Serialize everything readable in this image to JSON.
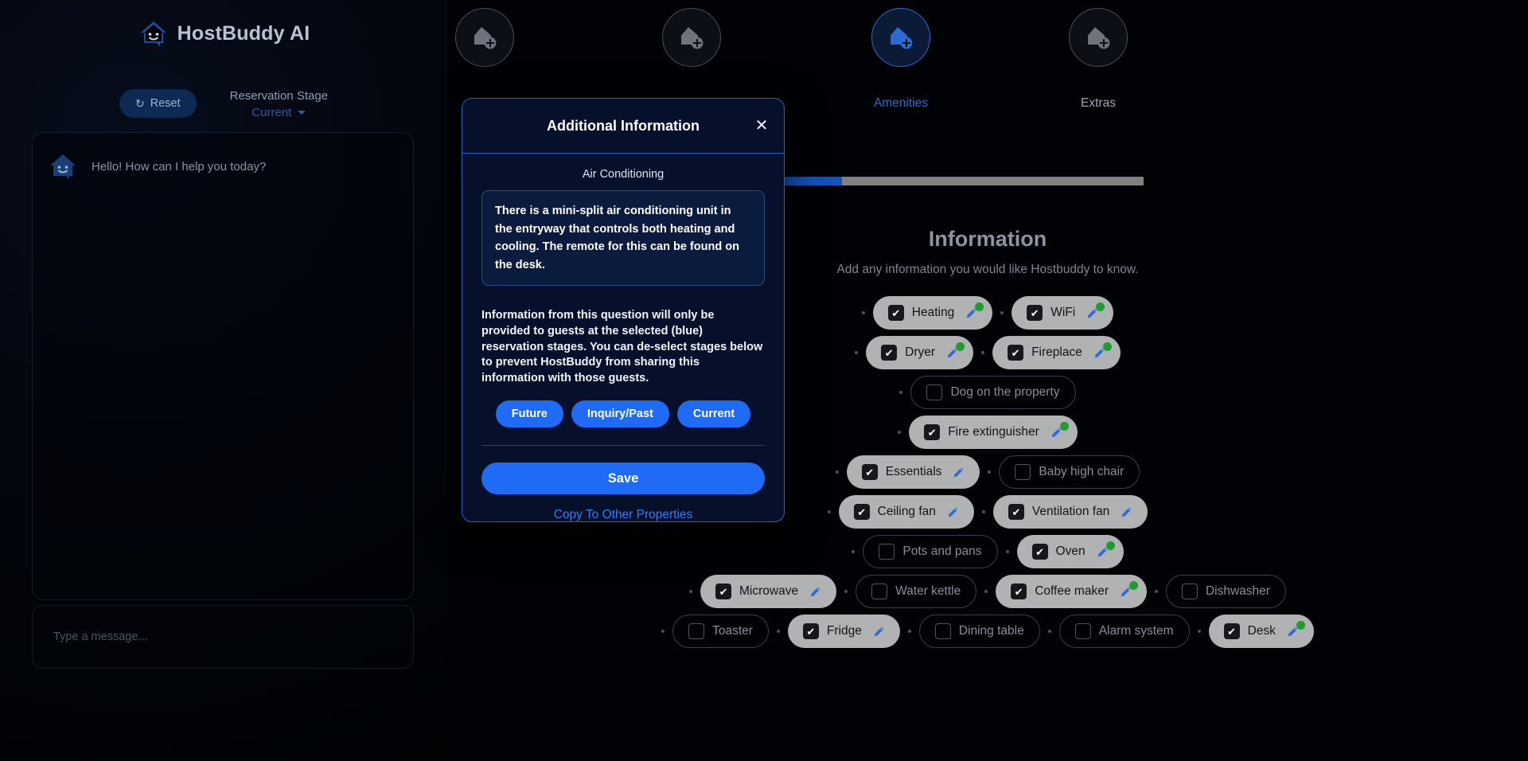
{
  "chat": {
    "brand": "HostBuddy AI",
    "brand_icon": "house-smile-logo",
    "reset_label": "Reset",
    "reset_icon": "refresh-icon",
    "stage_label": "Reservation Stage",
    "stage_value": "Current",
    "stage_caret_icon": "chevron-down-icon",
    "greeting": "Hello! How can I help you today?",
    "greeting_avatar_icon": "house-smile-avatar",
    "input_placeholder": "Type a message..."
  },
  "wizard": {
    "steps": [
      {
        "label": "",
        "icon": "house-plus-icon",
        "active": false
      },
      {
        "label": "",
        "icon": "house-plus-icon",
        "active": false
      },
      {
        "label": "Amenities",
        "icon": "house-plus-icon",
        "active": true
      },
      {
        "label": "Extras",
        "icon": "house-plus-icon",
        "active": false
      }
    ],
    "progress_percent": 48,
    "heading": "Information",
    "subheading": "Add any information you would like Hostbuddy to know.",
    "rows": [
      [
        {
          "label": "Heating",
          "checked": true,
          "edited": true
        },
        {
          "label": "WiFi",
          "checked": true,
          "edited": true
        }
      ],
      [
        {
          "label": "Dryer",
          "checked": true,
          "edited": true
        },
        {
          "label": "Fireplace",
          "checked": true,
          "edited": true
        }
      ],
      [
        {
          "label": "Dog on the property",
          "checked": false,
          "edited": false
        }
      ],
      [
        {
          "label": "Fire extinguisher",
          "checked": true,
          "edited": true
        }
      ],
      [
        {
          "label": "Essentials",
          "checked": true,
          "edited": false
        },
        {
          "label": "Baby high chair",
          "checked": false,
          "edited": false
        }
      ],
      [
        {
          "label": "Ceiling fan",
          "checked": true,
          "edited": false
        },
        {
          "label": "Ventilation fan",
          "checked": true,
          "edited": false
        }
      ],
      [
        {
          "label": "Pots and pans",
          "checked": false,
          "edited": false
        },
        {
          "label": "Oven",
          "checked": true,
          "edited": true
        }
      ],
      [
        {
          "label": "Microwave",
          "checked": true,
          "edited": false
        },
        {
          "label": "Water kettle",
          "checked": false,
          "edited": false
        },
        {
          "label": "Coffee maker",
          "checked": true,
          "edited": true
        },
        {
          "label": "Dishwasher",
          "checked": false,
          "edited": false
        }
      ],
      [
        {
          "label": "Toaster",
          "checked": false,
          "edited": false
        },
        {
          "label": "Fridge",
          "checked": true,
          "edited": false
        },
        {
          "label": "Dining table",
          "checked": false,
          "edited": false
        },
        {
          "label": "Alarm system",
          "checked": false,
          "edited": false
        },
        {
          "label": "Desk",
          "checked": true,
          "edited": true
        }
      ]
    ]
  },
  "modal": {
    "title": "Additional Information",
    "close_icon": "close-icon",
    "field_label": "Air Conditioning",
    "answer_text": "There is a mini-split air conditioning unit in the entryway that controls both heating and cooling. The remote for this can be found on the desk.",
    "stage_note": "Information from this question will only be provided to guests at the selected (blue) reservation stages. You can de-select stages below to prevent HostBuddy from sharing this information with those guests.",
    "stage_pills": [
      {
        "label": "Future",
        "selected": true
      },
      {
        "label": "Inquiry/Past",
        "selected": true
      },
      {
        "label": "Current",
        "selected": true
      }
    ],
    "save_label": "Save",
    "copy_label": "Copy To Other Properties"
  },
  "colors": {
    "accent_blue": "#1f6bf5",
    "modal_border": "#2b5fc4",
    "progress_fill": "#1452b8",
    "progress_track": "#808080",
    "chip_on_bg": "#b0b2b4",
    "green_dot": "#1f9b2f"
  }
}
